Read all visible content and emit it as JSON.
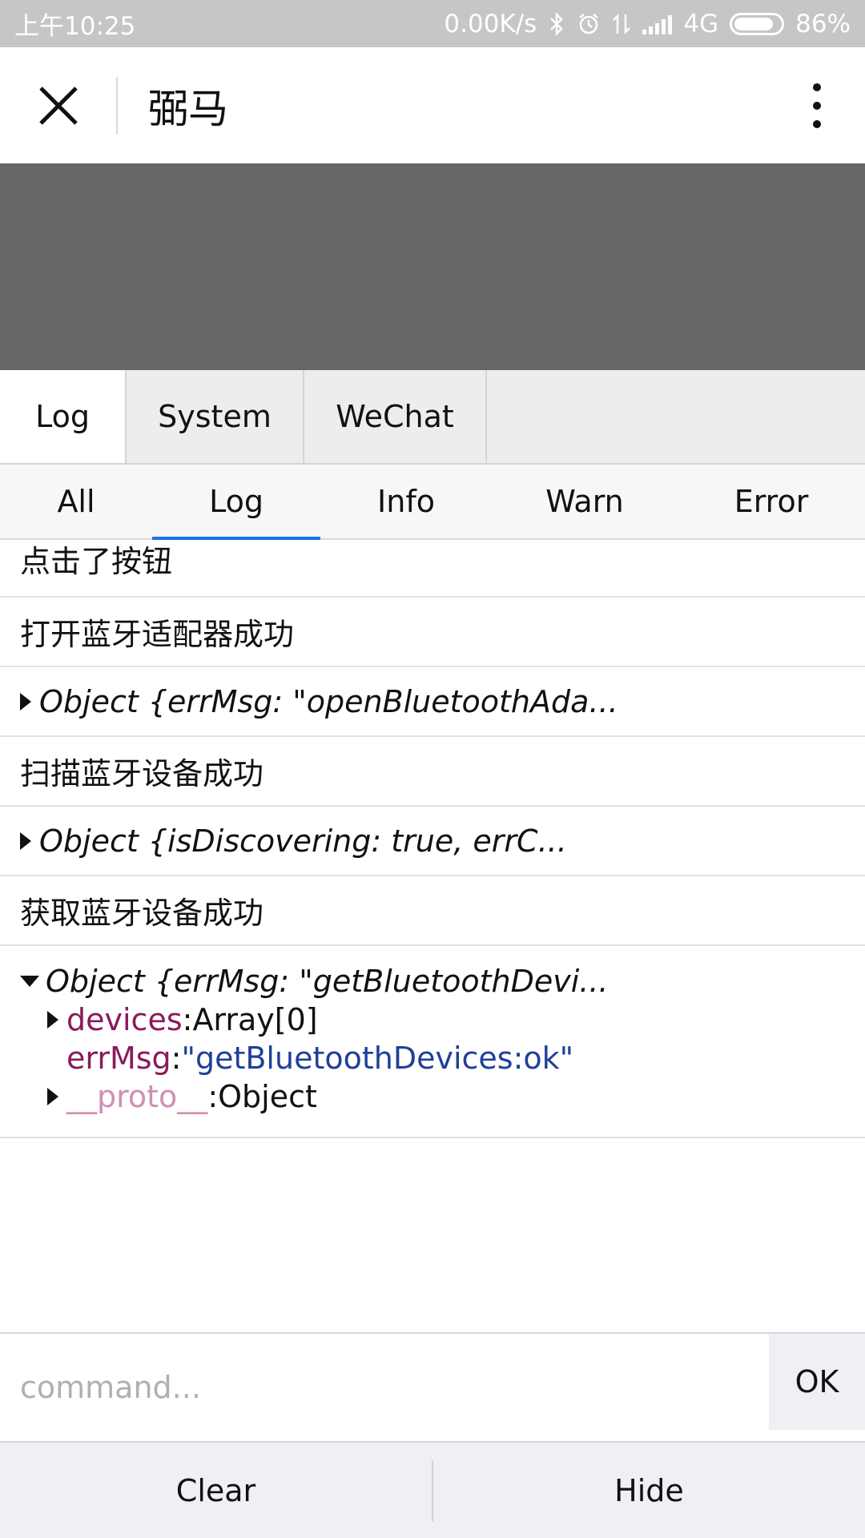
{
  "status_bar": {
    "time": "上午10:25",
    "network_speed": "0.00K/s",
    "network_type": "4G",
    "battery": "86%",
    "battery_level": 0.86,
    "icons": [
      "bluetooth-icon",
      "alarm-icon",
      "data-transfer-icon",
      "signal-icon",
      "battery-icon"
    ]
  },
  "navbar": {
    "title": "弼马",
    "close_icon": "close-icon",
    "more_icon": "more-vertical-icon"
  },
  "top_tabs": [
    {
      "label": "Log",
      "active": true
    },
    {
      "label": "System",
      "active": false
    },
    {
      "label": "WeChat",
      "active": false
    }
  ],
  "sub_tabs": [
    {
      "label": "All",
      "active": false
    },
    {
      "label": "Log",
      "active": true
    },
    {
      "label": "Info",
      "active": false
    },
    {
      "label": "Warn",
      "active": false
    },
    {
      "label": "Error",
      "active": false
    }
  ],
  "logs": {
    "row0": "点击了按钮",
    "row1": "打开蓝牙适配器成功",
    "row2": "Object {errMsg: \"openBluetoothAda...",
    "row3": "扫描蓝牙设备成功",
    "row4": "Object {isDiscovering: true, errC...",
    "row5": "获取蓝牙设备成功",
    "row6": {
      "head": "Object {errMsg: \"getBluetoothDevi...",
      "props": [
        {
          "key": "devices",
          "sep": ": ",
          "value": "Array[0]"
        },
        {
          "key": "errMsg",
          "sep": ": ",
          "value": "\"getBluetoothDevices:ok\""
        },
        {
          "key": "__proto__",
          "sep": ": ",
          "value": "Object"
        }
      ]
    }
  },
  "command": {
    "placeholder": "command...",
    "value": "",
    "ok_label": "OK"
  },
  "bottom_bar": {
    "clear_label": "Clear",
    "hide_label": "Hide"
  },
  "colors": {
    "accent": "#1a73e8",
    "key": "#8b1a5b",
    "proto_key": "#d08fb5",
    "string_value": "#1f3f9a",
    "banner": "#666666"
  }
}
